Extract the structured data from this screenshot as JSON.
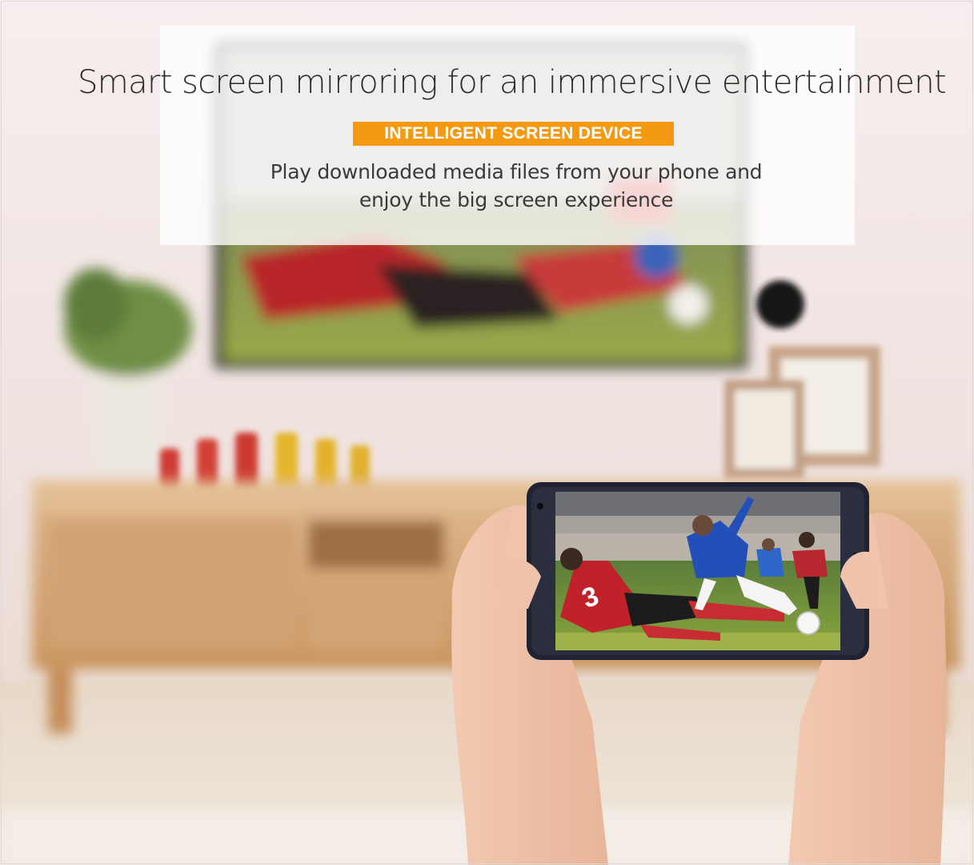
{
  "headline": "Smart screen mirroring for an immersive entertainment",
  "badge": "INTELLIGENT SCREEN DEVICE",
  "subtext": {
    "line1": "Play downloaded media files from your phone and",
    "line2": "enjoy the big screen experience"
  },
  "colors": {
    "badge_bg": "#f39a12",
    "headline_text": "#2b2b2b"
  },
  "phone_jersey_number": "3"
}
